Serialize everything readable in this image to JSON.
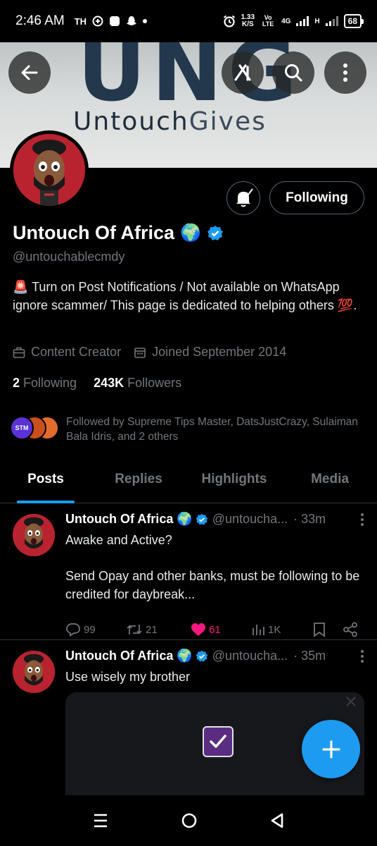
{
  "status_bar": {
    "time": "2:46 AM",
    "left_icons": [
      "TH",
      "vpn-icon",
      "app-icon",
      "snapchat-icon",
      "dot"
    ],
    "speed_top": "1.33",
    "speed_bottom": "K/S",
    "volte": "Vo LTE",
    "network_4g": "4G",
    "network_h": "H",
    "battery": "68"
  },
  "banner": {
    "logo_text": "UNG",
    "brand_bold": "Untouch",
    "brand_light": "Gives"
  },
  "header_buttons": [
    "back-arrow-icon",
    "grok-icon",
    "search-icon",
    "more-vertical-icon"
  ],
  "profile": {
    "name": "Untouch Of Africa",
    "name_emoji": "🌍",
    "handle": "@untouchablecmdy",
    "follow_button": "Following",
    "bio": "🚨 Turn on Post Notifications / Not available on WhatsApp ignore scammer/ This page is dedicated to helping others 💯.",
    "category": "Content Creator",
    "joined": "Joined September 2014",
    "following_count": "2",
    "following_label": "Following",
    "followers_count": "243K",
    "followers_label": "Followers",
    "followed_by": "Followed by Supreme Tips Master, DatsJustCrazy, Sulaiman Bala Idris, and 2 others",
    "followed_by_badge": "STM"
  },
  "tabs": [
    {
      "label": "Posts",
      "active": true
    },
    {
      "label": "Replies",
      "active": false
    },
    {
      "label": "Highlights",
      "active": false
    },
    {
      "label": "Media",
      "active": false
    }
  ],
  "posts": [
    {
      "name": "Untouch Of Africa",
      "emoji": "🌍",
      "handle": "@untoucha...",
      "time": "· 33m",
      "text": "Awake and Active?\n\nSend Opay and other banks, must be following to be credited for daybreak...",
      "replies": "99",
      "reposts": "21",
      "likes": "61",
      "views": "1K"
    },
    {
      "name": "Untouch Of Africa",
      "emoji": "🌍",
      "handle": "@untoucha...",
      "time": "· 35m",
      "text": "Use wisely my brother"
    }
  ],
  "colors": {
    "accent": "#1d9bf0",
    "like": "#f91880",
    "muted": "#71767b",
    "background": "#000000"
  }
}
